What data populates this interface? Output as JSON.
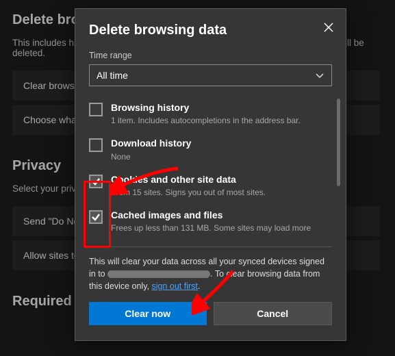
{
  "bg": {
    "heading1": "Delete browsing data",
    "sub1": "This includes history, passwords, cookies, and more. Only data from this profile will be deleted.",
    "card_clear": "Clear browsing data now",
    "card_choose": "Choose what to clear every time you close the browser",
    "heading2": "Privacy",
    "sub2": "Select your privacy settings for Microsoft Edge.",
    "card_dnt": "Send \"Do Not Track\" requests",
    "card_allow": "Allow sites to check if you have payment methods saved",
    "heading3": "Required diagnostic data"
  },
  "dialog": {
    "title": "Delete browsing data",
    "time_range_label": "Time range",
    "time_range_value": "All time",
    "items": [
      {
        "title": "Browsing history",
        "sub": "1 item. Includes autocompletions in the address bar.",
        "checked": false
      },
      {
        "title": "Download history",
        "sub": "None",
        "checked": false
      },
      {
        "title": "Cookies and other site data",
        "sub": "From 15 sites. Signs you out of most sites.",
        "checked": true
      },
      {
        "title": "Cached images and files",
        "sub": "Frees up less than 131 MB. Some sites may load more",
        "checked": true
      }
    ],
    "note_part1": "This will clear your data across all your synced devices signed in to ",
    "note_part2": ". To clear browsing data from this device only, ",
    "note_link": "sign out first",
    "note_part3": ".",
    "btn_primary": "Clear now",
    "btn_secondary": "Cancel"
  }
}
